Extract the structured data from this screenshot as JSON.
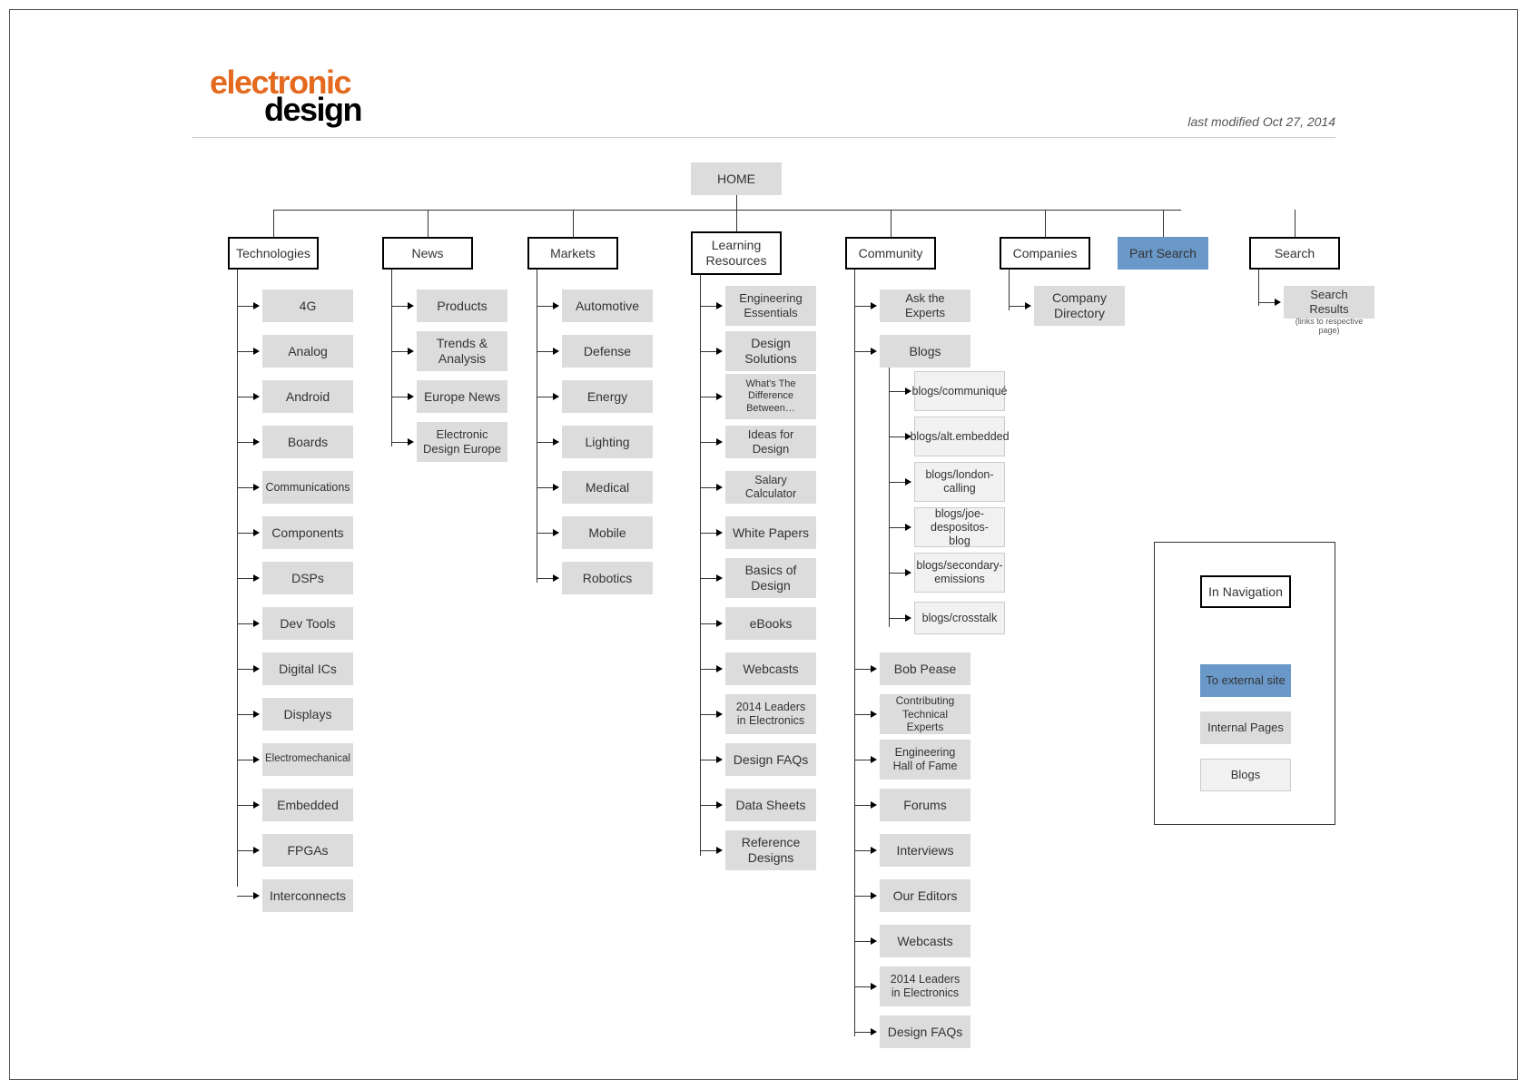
{
  "header": {
    "logo_line1": "electronic",
    "logo_line2": "design",
    "last_modified": "last modified Oct 27, 2014"
  },
  "root": "HOME",
  "categories": {
    "technologies": {
      "label": "Technologies",
      "children": [
        "4G",
        "Analog",
        "Android",
        "Boards",
        "Communications",
        "Components",
        "DSPs",
        "Dev Tools",
        "Digital ICs",
        "Displays",
        "Electromechanical",
        "Embedded",
        "FPGAs",
        "Interconnects"
      ]
    },
    "news": {
      "label": "News",
      "children": [
        "Products",
        "Trends & Analysis",
        "Europe News",
        "Electronic Design Europe"
      ]
    },
    "markets": {
      "label": "Markets",
      "children": [
        "Automotive",
        "Defense",
        "Energy",
        "Lighting",
        "Medical",
        "Mobile",
        "Robotics"
      ]
    },
    "learning": {
      "label": "Learning Resources",
      "children": [
        "Engineering Essentials",
        "Design Solutions",
        "What's The Difference Between…",
        "Ideas for Design",
        "Salary Calculator",
        "White Papers",
        "Basics of Design",
        "eBooks",
        "Webcasts",
        "2014 Leaders in Electronics",
        "Design FAQs",
        "Data Sheets",
        "Reference Designs"
      ]
    },
    "community": {
      "label": "Community",
      "children_a": [
        "Ask the Experts",
        "Blogs"
      ],
      "blogs": [
        "blogs/communiqué",
        "blogs/alt.embedded",
        "blogs/london-calling",
        "blogs/joe-despositos-blog",
        "blogs/secondary-emissions",
        "blogs/crosstalk"
      ],
      "children_b": [
        "Bob Pease",
        "Contributing Technical Experts",
        "Engineering Hall of Fame",
        "Forums",
        "Interviews",
        "Our Editors",
        "Webcasts",
        "2014 Leaders in Electronics",
        "Design FAQs"
      ]
    },
    "companies": {
      "label": "Companies",
      "children": [
        "Company Directory"
      ]
    },
    "part_search": {
      "label": "Part Search"
    },
    "search": {
      "label": "Search",
      "children": [
        "Search Results"
      ],
      "child_note": "(links to respective page)"
    }
  },
  "legend": {
    "in_navigation": "In Navigation",
    "to_external": "To external site",
    "internal_pages": "Internal Pages",
    "blogs": "Blogs"
  }
}
